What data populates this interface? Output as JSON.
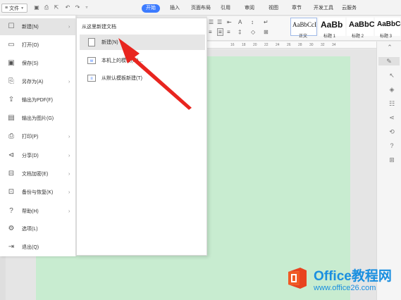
{
  "topbar": {
    "file_label": "文件",
    "tabs": [
      "开始",
      "插入",
      "页面布局",
      "引用",
      "审阅",
      "视图",
      "章节",
      "开发工具",
      "云服务"
    ],
    "active_tab": "开始",
    "accent": "#3c7bff"
  },
  "ribbon": {
    "styles": [
      {
        "sample": "AaBbCcI",
        "name": "正文"
      },
      {
        "sample": "AaBb",
        "name": "标题 1"
      },
      {
        "sample": "AaBbC",
        "name": "标题 2"
      },
      {
        "sample": "AaBbCc",
        "name": "标题 3"
      }
    ]
  },
  "ruler": {
    "ticks": [
      "16",
      "18",
      "20",
      "22",
      "24",
      "26",
      "28",
      "30",
      "32",
      "34"
    ]
  },
  "file_menu": {
    "items": [
      {
        "label": "新建(N)",
        "icon": "new-doc-icon",
        "arrow": true,
        "active": true
      },
      {
        "label": "打开(O)",
        "icon": "folder-icon",
        "arrow": false
      },
      {
        "label": "保存(S)",
        "icon": "save-icon",
        "arrow": false
      },
      {
        "label": "另存为(A)",
        "icon": "save-as-icon",
        "arrow": true
      },
      {
        "label": "输出为PDF(F)",
        "icon": "pdf-icon",
        "arrow": false
      },
      {
        "label": "输出为图片(G)",
        "icon": "image-icon",
        "arrow": false
      },
      {
        "label": "打印(P)",
        "icon": "print-icon",
        "arrow": true
      },
      {
        "label": "分享(D)",
        "icon": "share-icon",
        "arrow": true
      },
      {
        "label": "文档加密(E)",
        "icon": "lock-icon",
        "arrow": true
      },
      {
        "label": "备份与恢复(K)",
        "icon": "backup-icon",
        "arrow": true
      },
      {
        "label": "帮助(H)",
        "icon": "help-icon",
        "arrow": true
      },
      {
        "label": "选项(L)",
        "icon": "gear-icon",
        "arrow": false
      },
      {
        "label": "退出(Q)",
        "icon": "exit-icon",
        "arrow": false
      }
    ]
  },
  "submenu": {
    "header": "从这里新建文档",
    "items": [
      {
        "label": "新建(N)",
        "icon": "blank-doc-icon",
        "active": true
      },
      {
        "label": "本机上的模板(M)...",
        "icon": "local-template-icon"
      },
      {
        "label": "从默认模板新建(T)",
        "icon": "default-template-icon"
      }
    ]
  },
  "watermark": {
    "brand": "Office教程网",
    "url": "www.office26.com"
  }
}
